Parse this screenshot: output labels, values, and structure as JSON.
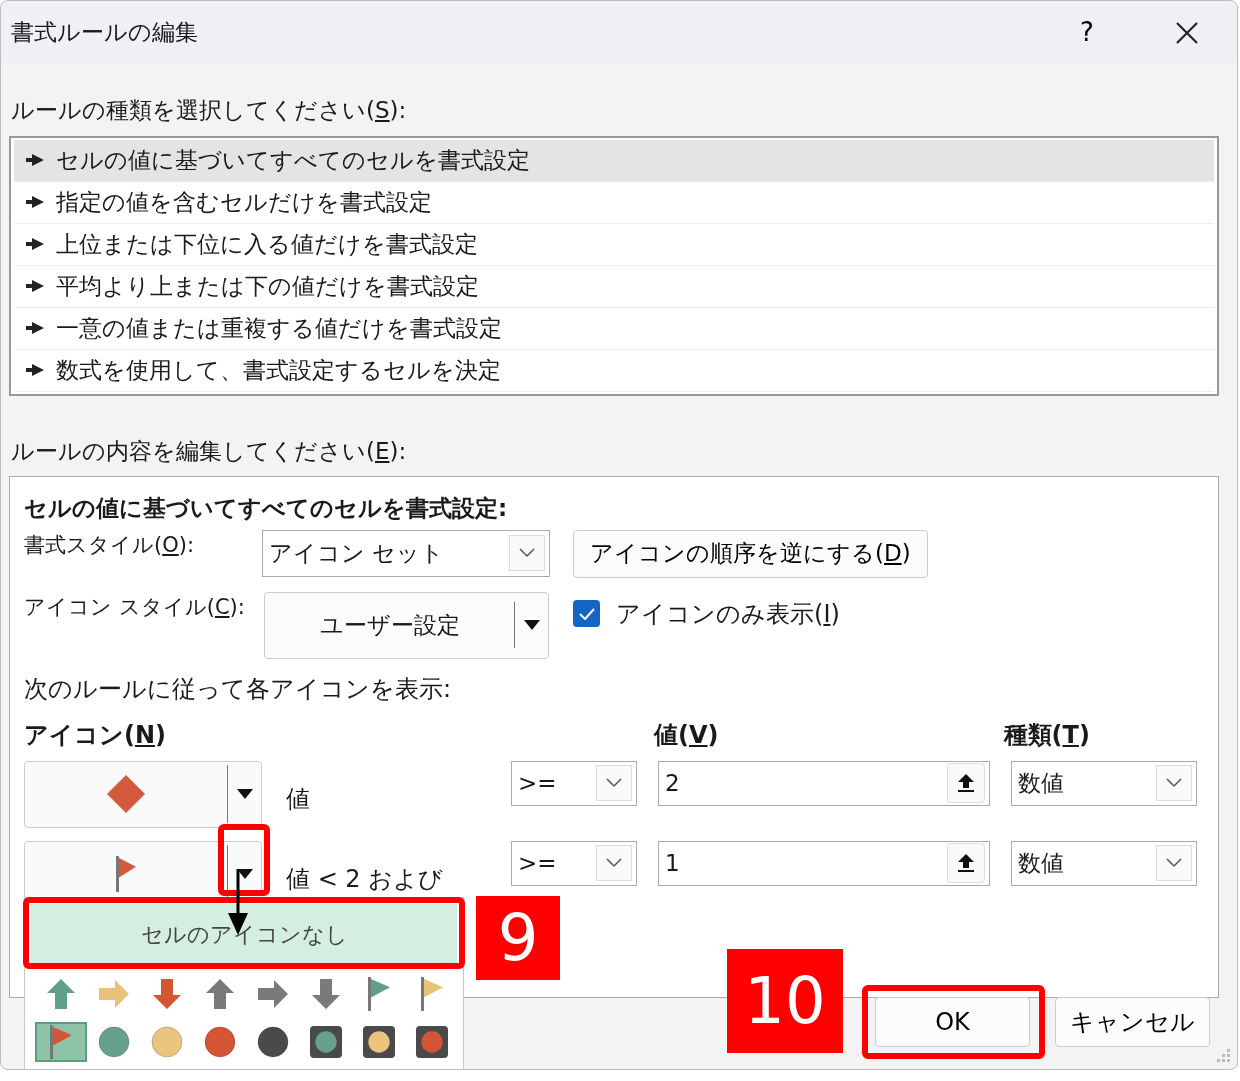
{
  "window": {
    "title": "書式ルールの編集",
    "help": "?"
  },
  "rule_type_label": {
    "text": "ルールの種類を選択してください(",
    "key": "S",
    "tail": "):"
  },
  "rule_types": [
    {
      "label": "セルの値に基づいてすべてのセルを書式設定",
      "selected": true
    },
    {
      "label": "指定の値を含むセルだけを書式設定",
      "selected": false
    },
    {
      "label": "上位または下位に入る値だけを書式設定",
      "selected": false
    },
    {
      "label": "平均より上または下の値だけを書式設定",
      "selected": false
    },
    {
      "label": "一意の値または重複する値だけを書式設定",
      "selected": false
    },
    {
      "label": "数式を使用して、書式設定するセルを決定",
      "selected": false
    }
  ],
  "edit_label": {
    "text": "ルールの内容を編集してください(",
    "key": "E",
    "tail": "):"
  },
  "panel": {
    "heading": "セルの値に基づいてすべてのセルを書式設定:",
    "format_style_label": {
      "text": "書式スタイル(",
      "key": "O",
      "tail": "):"
    },
    "format_style_value": "アイコン セット",
    "reverse_button": {
      "text": "アイコンの順序を逆にする(",
      "key": "D",
      "tail": ")"
    },
    "icon_style_label": {
      "text": "アイコン スタイル(",
      "key": "C",
      "tail": "):"
    },
    "icon_style_value": "ユーザー設定",
    "icon_only": {
      "text": "アイコンのみ表示(",
      "key": "I",
      "tail": ")",
      "checked": true
    },
    "rules_caption": "次のルールに従って各アイコンを表示:",
    "columns": [
      {
        "text": "アイコン(",
        "key": "N",
        "tail": ")"
      },
      {
        "text": "値(",
        "key": "V",
        "tail": ")"
      },
      {
        "text": "種類(",
        "key": "T",
        "tail": ")"
      }
    ],
    "icon_rules": [
      {
        "icon": {
          "kind": "diamond",
          "color": "#d35a3c"
        },
        "condition": "値",
        "operator": ">=",
        "value": "2",
        "type": "数値"
      },
      {
        "icon": {
          "kind": "flag",
          "color": "#d35a3c"
        },
        "condition": "値 < 2 および",
        "operator": ">=",
        "value": "1",
        "type": "数値"
      }
    ]
  },
  "icon_menu": {
    "no_icon": "セルのアイコンなし",
    "icons": [
      {
        "kind": "arrow-up",
        "color": "#5f9e8b",
        "selected": false
      },
      {
        "kind": "arrow-right",
        "color": "#e9c27a",
        "selected": false
      },
      {
        "kind": "arrow-down",
        "color": "#d35534",
        "selected": false
      },
      {
        "kind": "arrow-up",
        "color": "#7a7a7a",
        "selected": false
      },
      {
        "kind": "arrow-right",
        "color": "#7a7a7a",
        "selected": false
      },
      {
        "kind": "arrow-down",
        "color": "#7a7a7a",
        "selected": false
      },
      {
        "kind": "flag",
        "color": "#5f9e8b",
        "selected": false
      },
      {
        "kind": "flag",
        "color": "#e9c27a",
        "selected": false
      },
      {
        "kind": "flag",
        "color": "#d35534",
        "selected": true
      },
      {
        "kind": "circle",
        "color": "#66a08e",
        "selected": false
      },
      {
        "kind": "circle",
        "color": "#ebc47e",
        "selected": false
      },
      {
        "kind": "circle",
        "color": "#d35534",
        "selected": false
      },
      {
        "kind": "circle",
        "color": "#4a4a4a",
        "selected": false
      },
      {
        "kind": "light",
        "color": "#66a08e",
        "selected": false
      },
      {
        "kind": "light",
        "color": "#ebc47e",
        "selected": false
      },
      {
        "kind": "light",
        "color": "#d35534",
        "selected": false
      }
    ]
  },
  "buttons": [
    {
      "label": "OK"
    },
    {
      "label": "キャンセル"
    }
  ],
  "callouts": [
    {
      "label": "9"
    },
    {
      "label": "10"
    }
  ]
}
